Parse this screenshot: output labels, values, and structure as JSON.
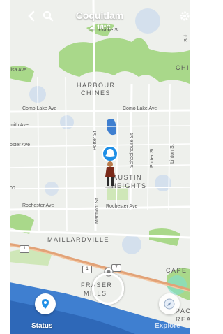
{
  "header": {
    "location": "Coquitlam",
    "weather": "18°C",
    "back_icon": "chevron-left-icon",
    "search_icon": "search-icon",
    "settings_icon": "gear-icon"
  },
  "map": {
    "neighborhoods": {
      "harbour": "HARBOUR",
      "chines": "CHINES",
      "austin": "AUSTIN",
      "heights": "HEIGHTS",
      "maillardville": "MAILLARDVILLE",
      "fraser": "FRASER",
      "mills": "MILLS",
      "cape": "CAPE H",
      "pacific": "PAC",
      "reach": "REA",
      "chi": "CHI"
    },
    "streets": {
      "clarke": "Clarke St",
      "como1": "Como Lake Ave",
      "como2": "Como Lake Ave",
      "smith": "mith Ave",
      "foster": "oster Ave",
      "ilsa": "ilsa Ave",
      "rochester1": "Rochester Ave",
      "rochester2": "Rochester Ave",
      "porter": "Porter St",
      "schoolhouse": "Schoolhouse St",
      "porter2": "Porter St",
      "linton": "Linton St",
      "marmont": "Marmont St",
      "oo": "00",
      "sch": "Sch"
    },
    "highways": [
      "1",
      "1",
      "7"
    ]
  },
  "bottom": {
    "status_label": "Status",
    "explore_label": "Explore"
  },
  "colors": {
    "park": "#a9d88a",
    "water": "#3f7fd0",
    "accent_blue": "#1f8fe6"
  }
}
